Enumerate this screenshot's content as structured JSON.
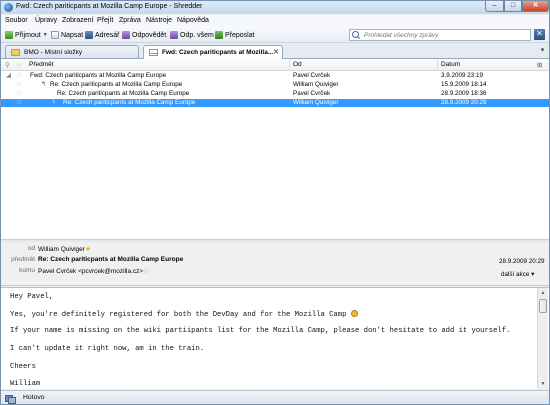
{
  "window": {
    "title": "Fwd: Czech pariticpants at Mozilla Camp Europe - Shredder",
    "min_glyph": "–",
    "max_glyph": "□",
    "close_glyph": "✕"
  },
  "menubar": {
    "items": [
      "Soubor",
      "Úpravy",
      "Zobrazení",
      "Přejít",
      "Zpráva",
      "Nástroje",
      "Nápověda"
    ]
  },
  "toolbar": {
    "receive_label": "Přijmout",
    "write_label": "Napsat",
    "addressbook_label": "Adresář",
    "reply_label": "Odpovědět",
    "replyall_label": "Odp. všem",
    "forward_label": "Přeposlat",
    "dropdown_glyph": "▼",
    "search_placeholder": "Prohledat všechny zprávy",
    "close_glyph": "✕"
  },
  "tabs": {
    "items": [
      {
        "label": "BMO - Místní složky"
      },
      {
        "label": "Fwd: Czech pariticpants at Mozilla..."
      }
    ],
    "close_glyph": "✕",
    "menu_glyph": "▾"
  },
  "thread_pane": {
    "columns": {
      "subject": "Předmět",
      "from": "Od",
      "date": "Datum"
    },
    "rows": [
      {
        "subject": "Fwd: Czech pariticpants at Mozilla Camp Europe",
        "from": "Pavel Cvrček",
        "date": "3.9.2009 23:19",
        "selected": false
      },
      {
        "subject": "Re: Czech pariticpants at Mozilla Camp Europe",
        "from": "William Quiviger",
        "date": "15.9.2009 18:14",
        "selected": false
      },
      {
        "subject": "Re: Czech pariticpants at Mozilla Camp Europe",
        "from": "Pavel Cvrček",
        "date": "28.9.2009 18:36",
        "selected": false
      },
      {
        "subject": "Re: Czech pariticpants at Mozilla Camp Europe",
        "from": "William Quiviger",
        "date": "28.9.2009 20:29",
        "selected": true
      }
    ]
  },
  "message_header": {
    "from_label": "od",
    "from_value": "William Quiviger",
    "subject_label": "předmět",
    "subject_value": "Re: Czech pariticpants at Mozilla Camp Europe",
    "to_label": "komu",
    "to_value": "Pavel Cvrček <pcvrcek@mozilla.cz>",
    "date": "28.9.2009 20:29",
    "more_actions": "další akce ▾"
  },
  "message_body": {
    "lines": [
      "Hey Pavel,",
      "Yes, you're definitely registered for both the DevDay and for the Mozilla Camp",
      "If your name is missing on the wiki partiipants list for the Mozilla Camp, please don't hesitate to add it yourself.",
      "I can't update it right now, am in the train.",
      "Cheers",
      "William"
    ]
  },
  "statusbar": {
    "text": "Hotovo"
  },
  "colors": {
    "selection": "#3399ff",
    "titlebar": "#c3d8ee",
    "star": "#e2b532"
  }
}
